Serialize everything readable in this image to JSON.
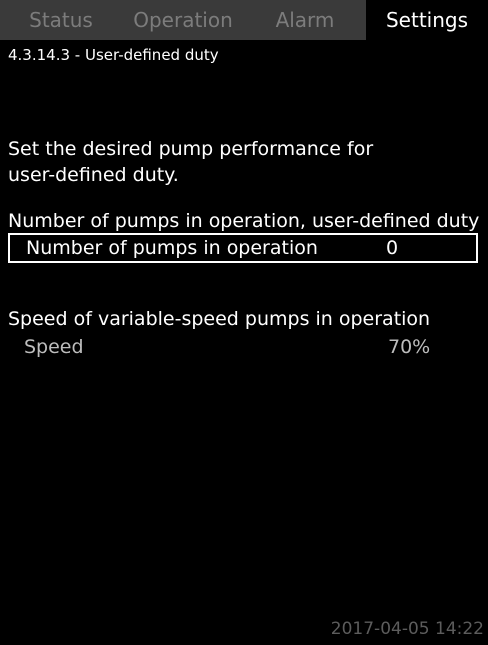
{
  "tabs": [
    {
      "label": "Status"
    },
    {
      "label": "Operation"
    },
    {
      "label": "Alarm"
    },
    {
      "label": "Settings"
    }
  ],
  "breadcrumb": "4.3.14.3 - User-defined duty",
  "description": {
    "line1": "Set the desired pump performance for",
    "line2": "user-defined duty."
  },
  "pumps_group": {
    "title": "Number of pumps in operation, user-defined duty",
    "row_label": "Number of pumps in operation",
    "row_value": "0"
  },
  "speed_group": {
    "title": "Speed of variable-speed pumps in operation",
    "row_label": "Speed",
    "row_value": "70%"
  },
  "datetime": "2017-04-05 14:22",
  "colors": {
    "tab_bar": "#3a3a3a",
    "inactive_tab_text": "#7c7c7c",
    "background": "#000000",
    "text": "#ffffff"
  }
}
